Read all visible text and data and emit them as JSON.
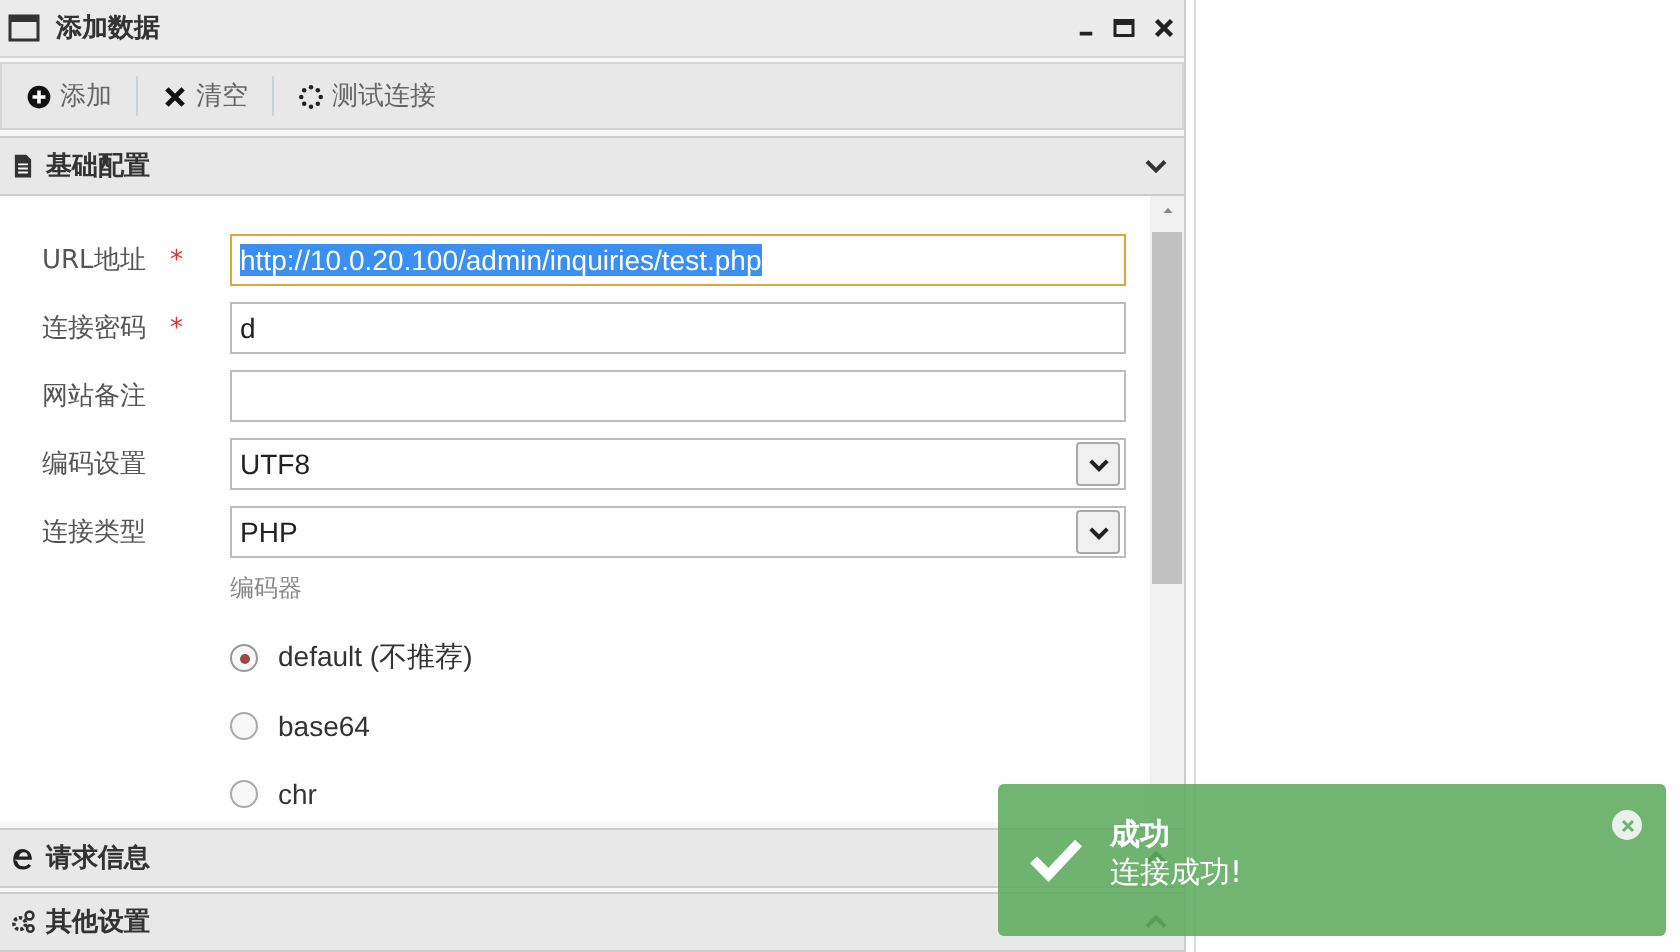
{
  "window": {
    "title": "添加数据"
  },
  "toolbar": [
    {
      "kind": "add",
      "label": "添加"
    },
    {
      "kind": "clear",
      "label": "清空"
    },
    {
      "kind": "test",
      "label": "测试连接"
    }
  ],
  "sections": [
    {
      "kind": "doc",
      "title": "基础配置",
      "expanded": true
    },
    {
      "kind": "edge",
      "title": "请求信息",
      "expanded": false
    },
    {
      "kind": "gears",
      "title": "其他设置",
      "expanded": false
    }
  ],
  "form": {
    "fields": [
      {
        "kind": "text",
        "label": "URL地址",
        "required_mark": "*",
        "value": "http://10.0.20.100/admin/inquiries/test.php",
        "focused": true
      },
      {
        "kind": "text",
        "label": "连接密码",
        "required_mark": "*",
        "value": "d",
        "focused": false
      },
      {
        "kind": "text",
        "label": "网站备注",
        "focused": false
      },
      {
        "kind": "select",
        "label": "编码设置",
        "value": "UTF8",
        "focused": false
      },
      {
        "kind": "select",
        "label": "连接类型",
        "value": "PHP",
        "focused": false
      }
    ],
    "encoder_label": "编码器",
    "encoders": [
      {
        "label": "default (不推荐)",
        "selected": true
      },
      {
        "label": "base64",
        "selected": false
      },
      {
        "label": "chr",
        "selected": false
      }
    ]
  },
  "toast": {
    "title": "成功",
    "message": "连接成功!"
  }
}
